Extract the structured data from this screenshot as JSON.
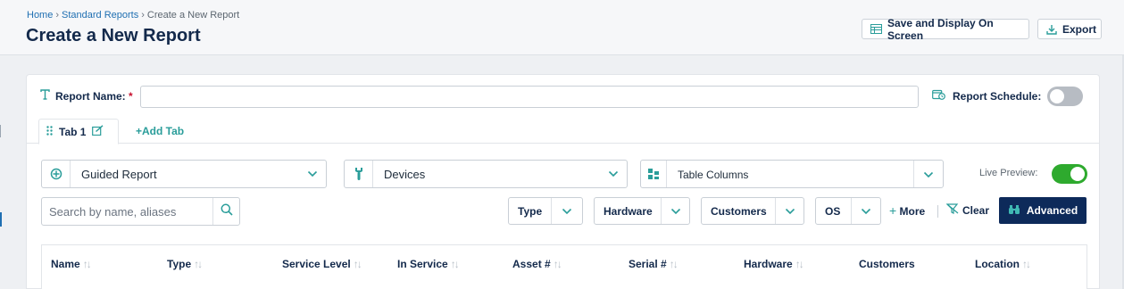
{
  "breadcrumb": {
    "home": "Home",
    "parent": "Standard Reports",
    "current": "Create a New Report",
    "separator": "›"
  },
  "page": {
    "title": "Create a New Report"
  },
  "header_actions": {
    "save_display": "Save and Display On Screen",
    "export": "Export"
  },
  "report_name": {
    "label": "Report Name:",
    "required_marker": "*",
    "value": ""
  },
  "report_schedule": {
    "label": "Report Schedule:",
    "enabled": false
  },
  "tabs": [
    {
      "label": "Tab 1"
    }
  ],
  "add_tab": {
    "label": "Add Tab"
  },
  "selectors": {
    "report_type": {
      "value": "Guided Report",
      "icon": "crosshair-icon"
    },
    "entity": {
      "value": "Devices",
      "icon": "wrench-icon"
    },
    "columns": {
      "value": "Table Columns",
      "icon": "grid-icon"
    }
  },
  "live_preview": {
    "label": "Live Preview:",
    "enabled": true
  },
  "search": {
    "placeholder": "Search by name, aliases",
    "value": ""
  },
  "filters": [
    {
      "label": "Type"
    },
    {
      "label": "Hardware"
    },
    {
      "label": "Customers"
    },
    {
      "label": "OS"
    }
  ],
  "more": {
    "label": "More"
  },
  "clear": {
    "label": "Clear"
  },
  "advanced": {
    "label": "Advanced"
  },
  "table": {
    "columns": [
      {
        "label": "Name",
        "sortable": true
      },
      {
        "label": "Type",
        "sortable": true
      },
      {
        "label": "Service Level",
        "sortable": true
      },
      {
        "label": "In Service",
        "sortable": true
      },
      {
        "label": "Asset #",
        "sortable": true
      },
      {
        "label": "Serial #",
        "sortable": true
      },
      {
        "label": "Hardware",
        "sortable": true
      },
      {
        "label": "Customers",
        "sortable": false
      },
      {
        "label": "Location",
        "sortable": true
      }
    ]
  },
  "colors": {
    "accent_teal": "#2a9d9a",
    "brand_navy": "#13294b",
    "button_navy": "#0d2a5a",
    "toggle_on": "#2eaa2e",
    "toggle_off": "#b7bcc3",
    "required": "#c8102e"
  }
}
